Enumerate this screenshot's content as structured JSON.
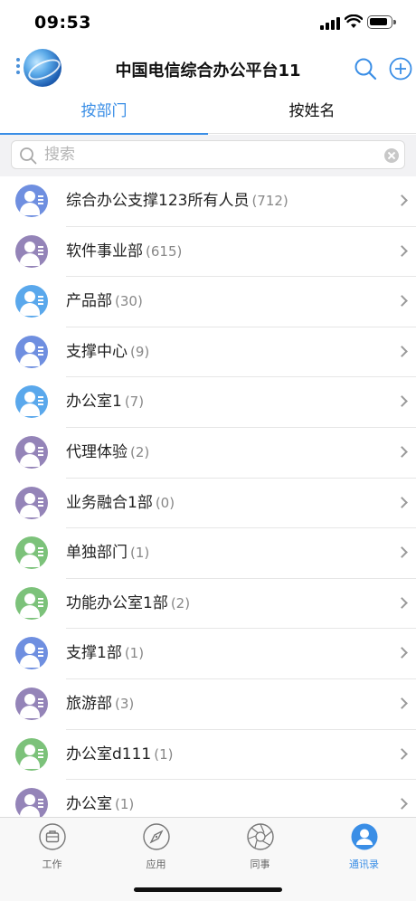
{
  "status_bar": {
    "time": "09:53"
  },
  "header": {
    "title": "中国电信综合办公平台11"
  },
  "tabs": [
    {
      "label": "按部门"
    },
    {
      "label": "按姓名"
    }
  ],
  "search": {
    "placeholder": "搜索"
  },
  "departments": [
    {
      "name": "综合办公支撑123所有人员",
      "count": "(712)",
      "color": "#6f8fe0"
    },
    {
      "name": "软件事业部",
      "count": "(615)",
      "color": "#9484b8"
    },
    {
      "name": "产品部",
      "count": "(30)",
      "color": "#5aa8ec"
    },
    {
      "name": "支撑中心",
      "count": "(9)",
      "color": "#6f8fe0"
    },
    {
      "name": "办公室1",
      "count": "(7)",
      "color": "#5aa8ec"
    },
    {
      "name": "代理体验",
      "count": "(2)",
      "color": "#9484b8"
    },
    {
      "name": "业务融合1部",
      "count": "(0)",
      "color": "#9484b8"
    },
    {
      "name": "单独部门",
      "count": "(1)",
      "color": "#7cc27a"
    },
    {
      "name": "功能办公室1部",
      "count": "(2)",
      "color": "#7cc27a"
    },
    {
      "name": "支撑1部",
      "count": "(1)",
      "color": "#6f8fe0"
    },
    {
      "name": "旅游部",
      "count": "(3)",
      "color": "#9484b8"
    },
    {
      "name": "办公室d111",
      "count": "(1)",
      "color": "#7cc27a"
    },
    {
      "name": "办公室",
      "count": "(1)",
      "color": "#9484b8"
    }
  ],
  "tabbar": {
    "items": [
      {
        "label": "工作",
        "icon": "briefcase-icon"
      },
      {
        "label": "应用",
        "icon": "compass-icon"
      },
      {
        "label": "同事",
        "icon": "aperture-icon"
      },
      {
        "label": "通讯录",
        "icon": "contacts-icon"
      }
    ],
    "active_color": "#3a8ee6"
  }
}
